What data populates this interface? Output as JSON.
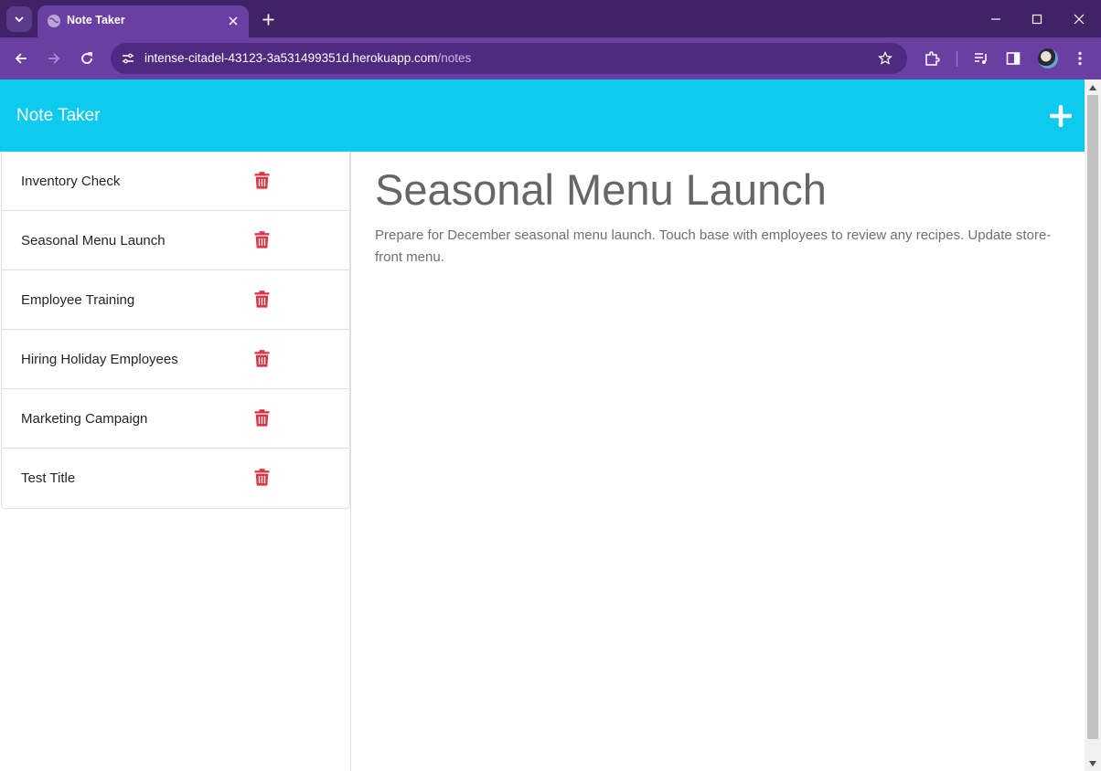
{
  "browser": {
    "tab_title": "Note Taker",
    "url_host": "intense-citadel-43123-3a531499351d.herokuapp.com",
    "url_path": "/notes"
  },
  "app": {
    "brand": "Note Taker"
  },
  "notes": [
    {
      "title": "Inventory Check"
    },
    {
      "title": "Seasonal Menu Launch"
    },
    {
      "title": "Employee Training"
    },
    {
      "title": "Hiring Holiday Employees"
    },
    {
      "title": "Marketing Campaign"
    },
    {
      "title": "Test Title"
    }
  ],
  "active_note": {
    "title": "Seasonal Menu Launch",
    "text": "Prepare for December seasonal menu launch. Touch base with employees to review any recipes. Update store-front menu."
  },
  "colors": {
    "navbar": "#0dcaf0",
    "trash": "#dc3545",
    "chrome": "#6a3fa3"
  }
}
